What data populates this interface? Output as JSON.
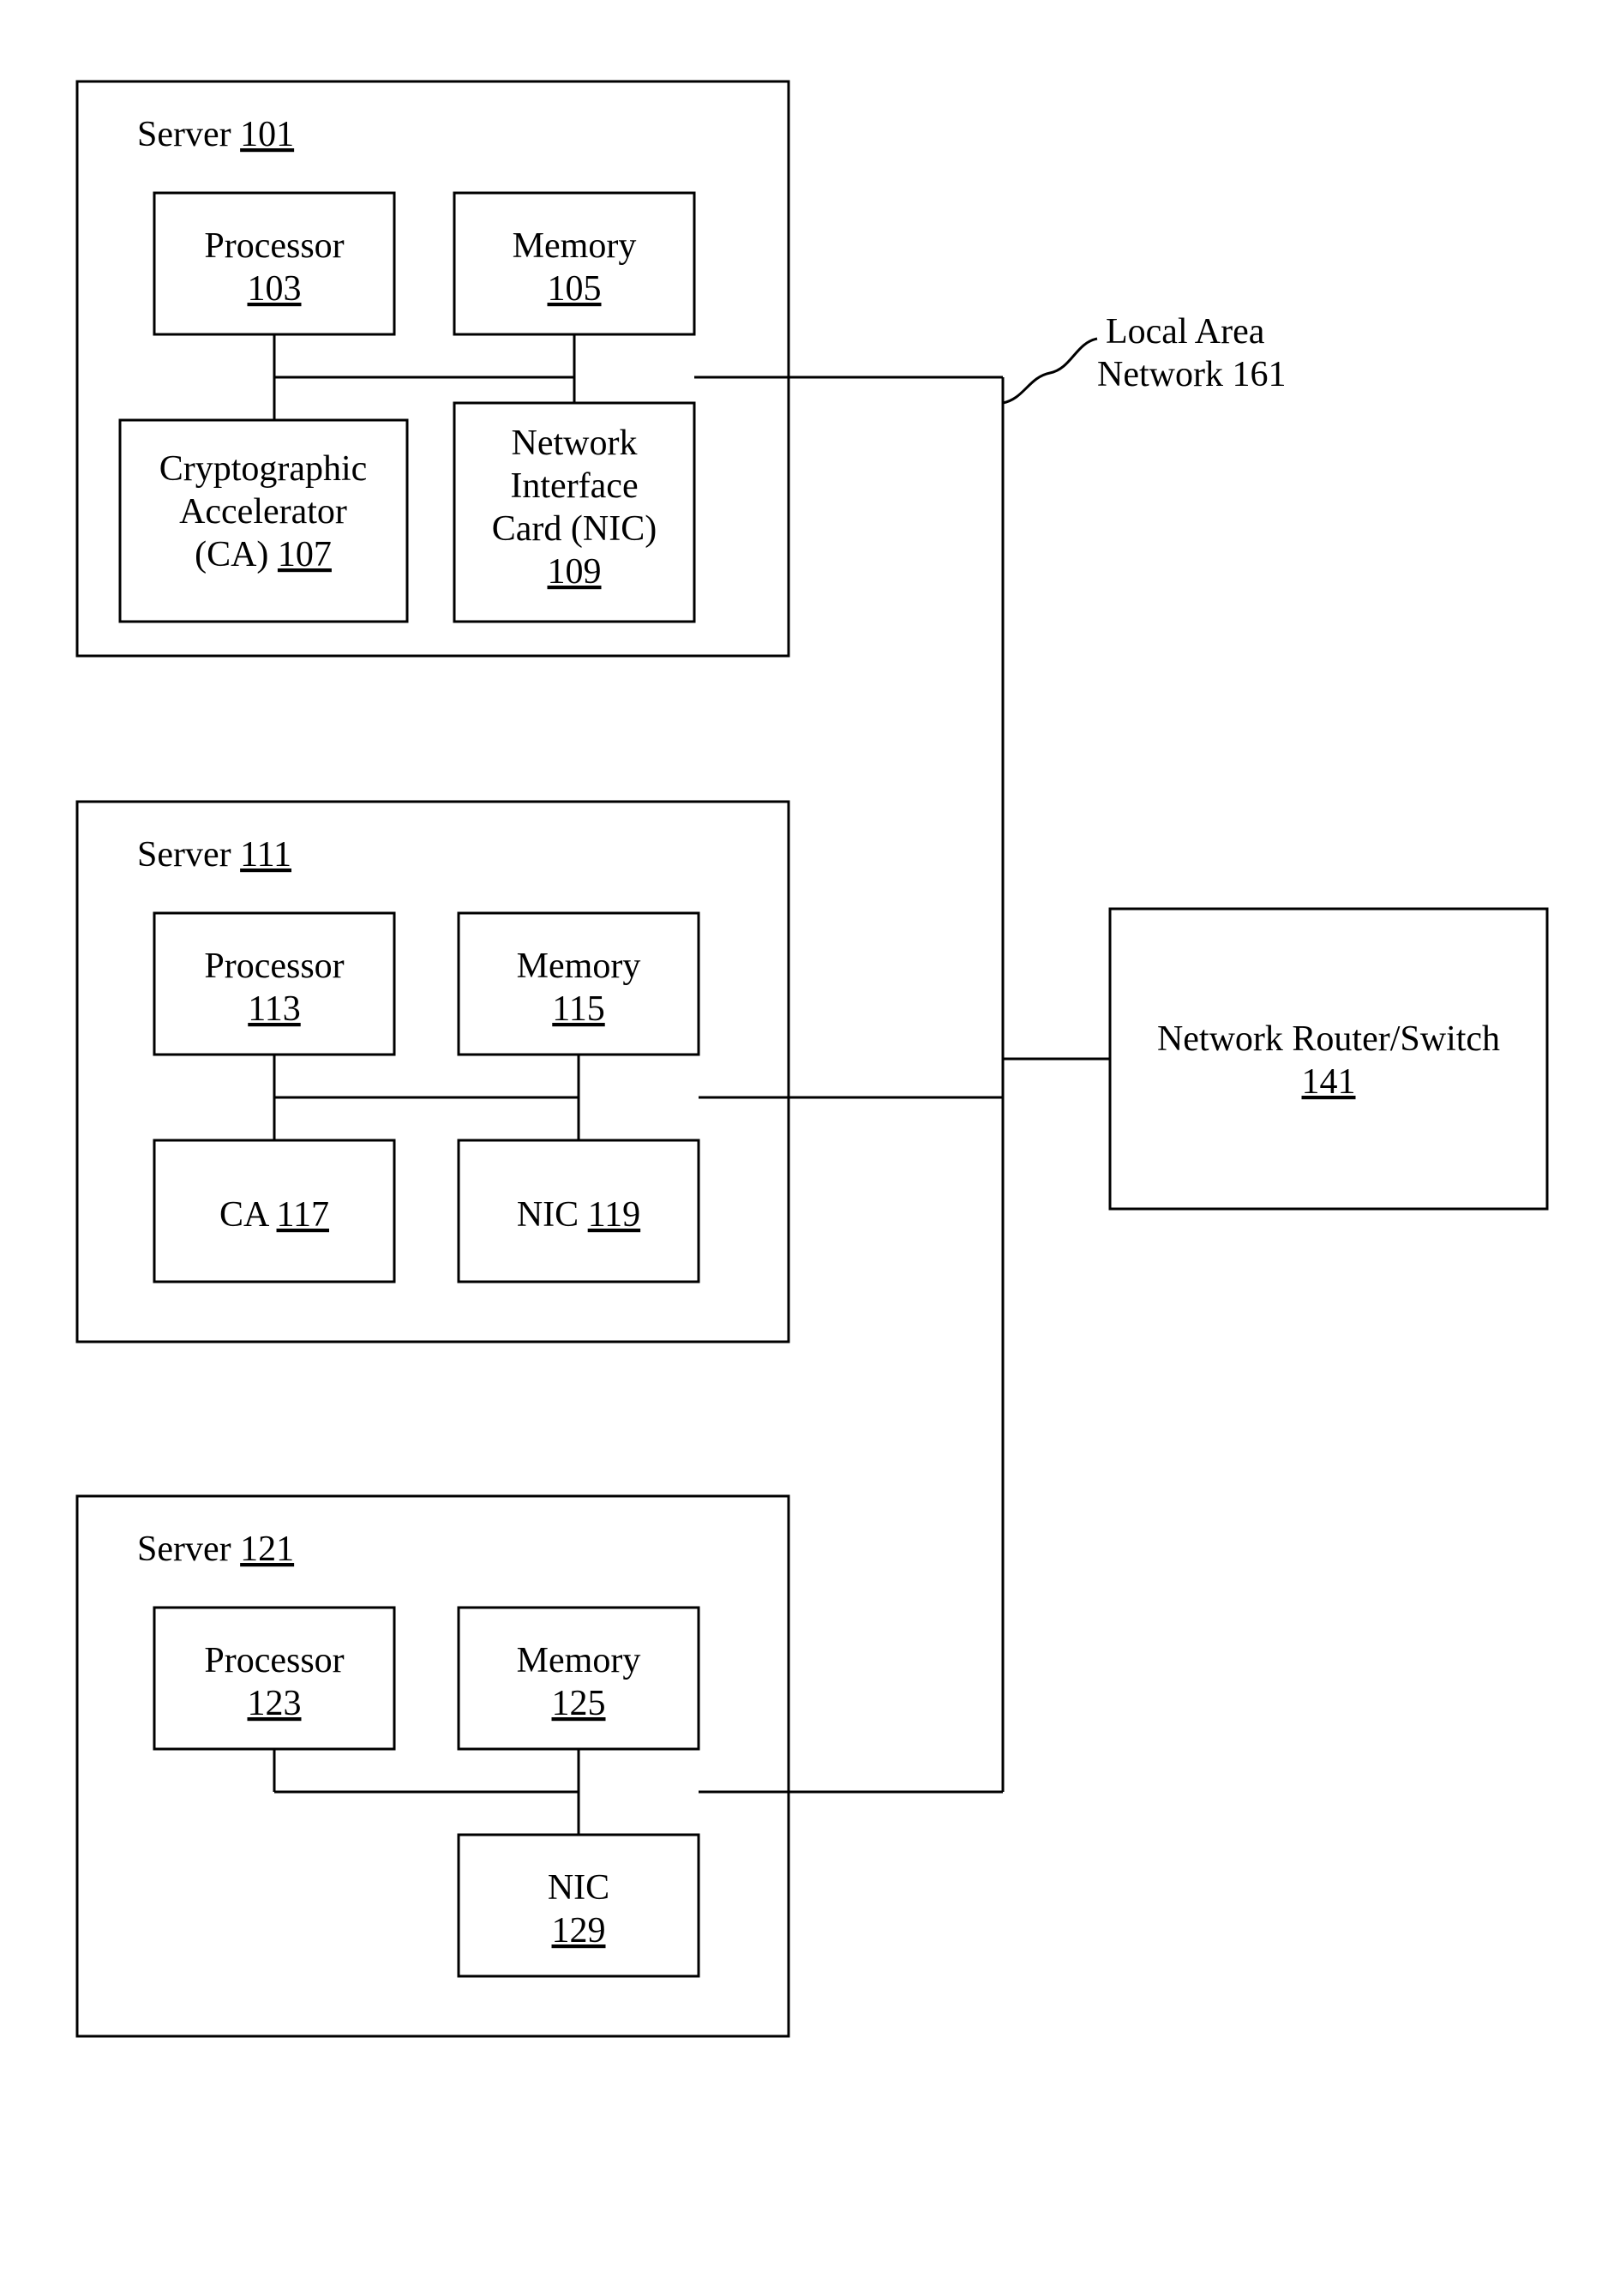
{
  "lan": {
    "line1": "Local Area",
    "line2": "Network 161",
    "ref": "161"
  },
  "router": {
    "label": "Network Router/Switch",
    "ref": "141"
  },
  "servers": [
    {
      "title": "Server",
      "ref": "101",
      "processor": {
        "label": "Processor",
        "ref": "103"
      },
      "memory": {
        "label": "Memory",
        "ref": "105"
      },
      "ca": {
        "line1": "Cryptographic",
        "line2": "Accelerator",
        "line3_prefix": "(CA)",
        "ref": "107"
      },
      "nic": {
        "line1": "Network",
        "line2": "Interface",
        "line3": "Card (NIC)",
        "ref": "109"
      }
    },
    {
      "title": "Server",
      "ref": "111",
      "processor": {
        "label": "Processor",
        "ref": "113"
      },
      "memory": {
        "label": "Memory",
        "ref": "115"
      },
      "ca_short": {
        "label": "CA",
        "ref": "117"
      },
      "nic_short": {
        "label": "NIC",
        "ref": "119"
      }
    },
    {
      "title": "Server",
      "ref": "121",
      "processor": {
        "label": "Processor",
        "ref": "123"
      },
      "memory": {
        "label": "Memory",
        "ref": "125"
      },
      "nic_short": {
        "label": "NIC",
        "ref": "129"
      }
    }
  ]
}
